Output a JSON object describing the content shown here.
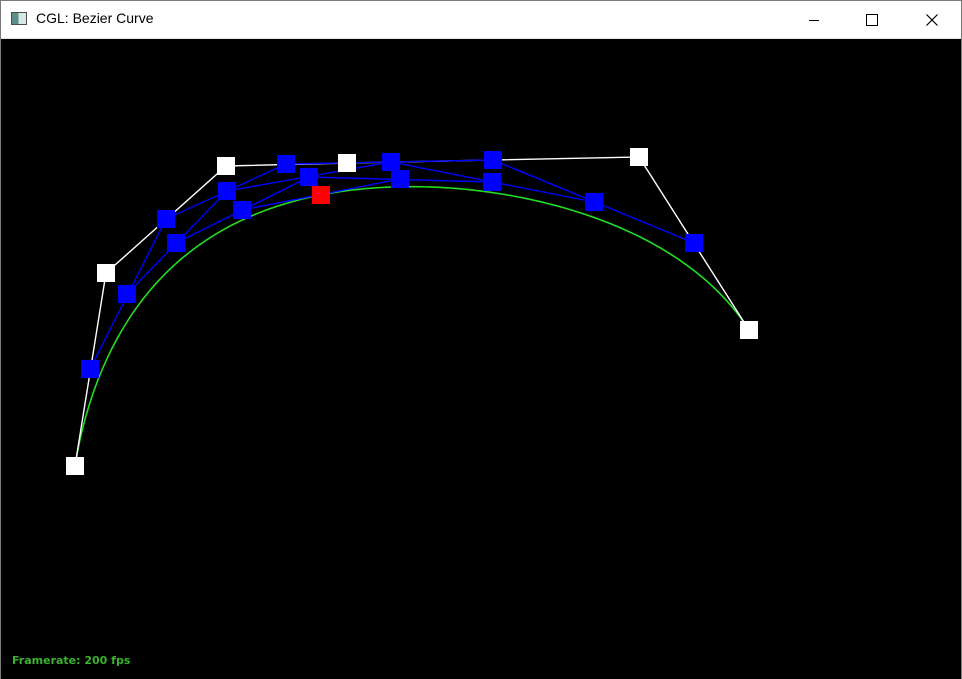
{
  "window": {
    "title": "CGL: Bezier Curve",
    "icon": "app-window-icon",
    "controls": [
      "minimize-icon",
      "maximize-icon",
      "close-icon"
    ]
  },
  "scene": {
    "background": "#000000",
    "curve_color": "#22dd22",
    "control_color": "#ffffff",
    "intermediate_color": "#0000ff",
    "evaluated_color": "#ff0000"
  },
  "status": {
    "framerate": "Framerate: 200 fps",
    "framerate_color": "#3bb32f"
  }
}
